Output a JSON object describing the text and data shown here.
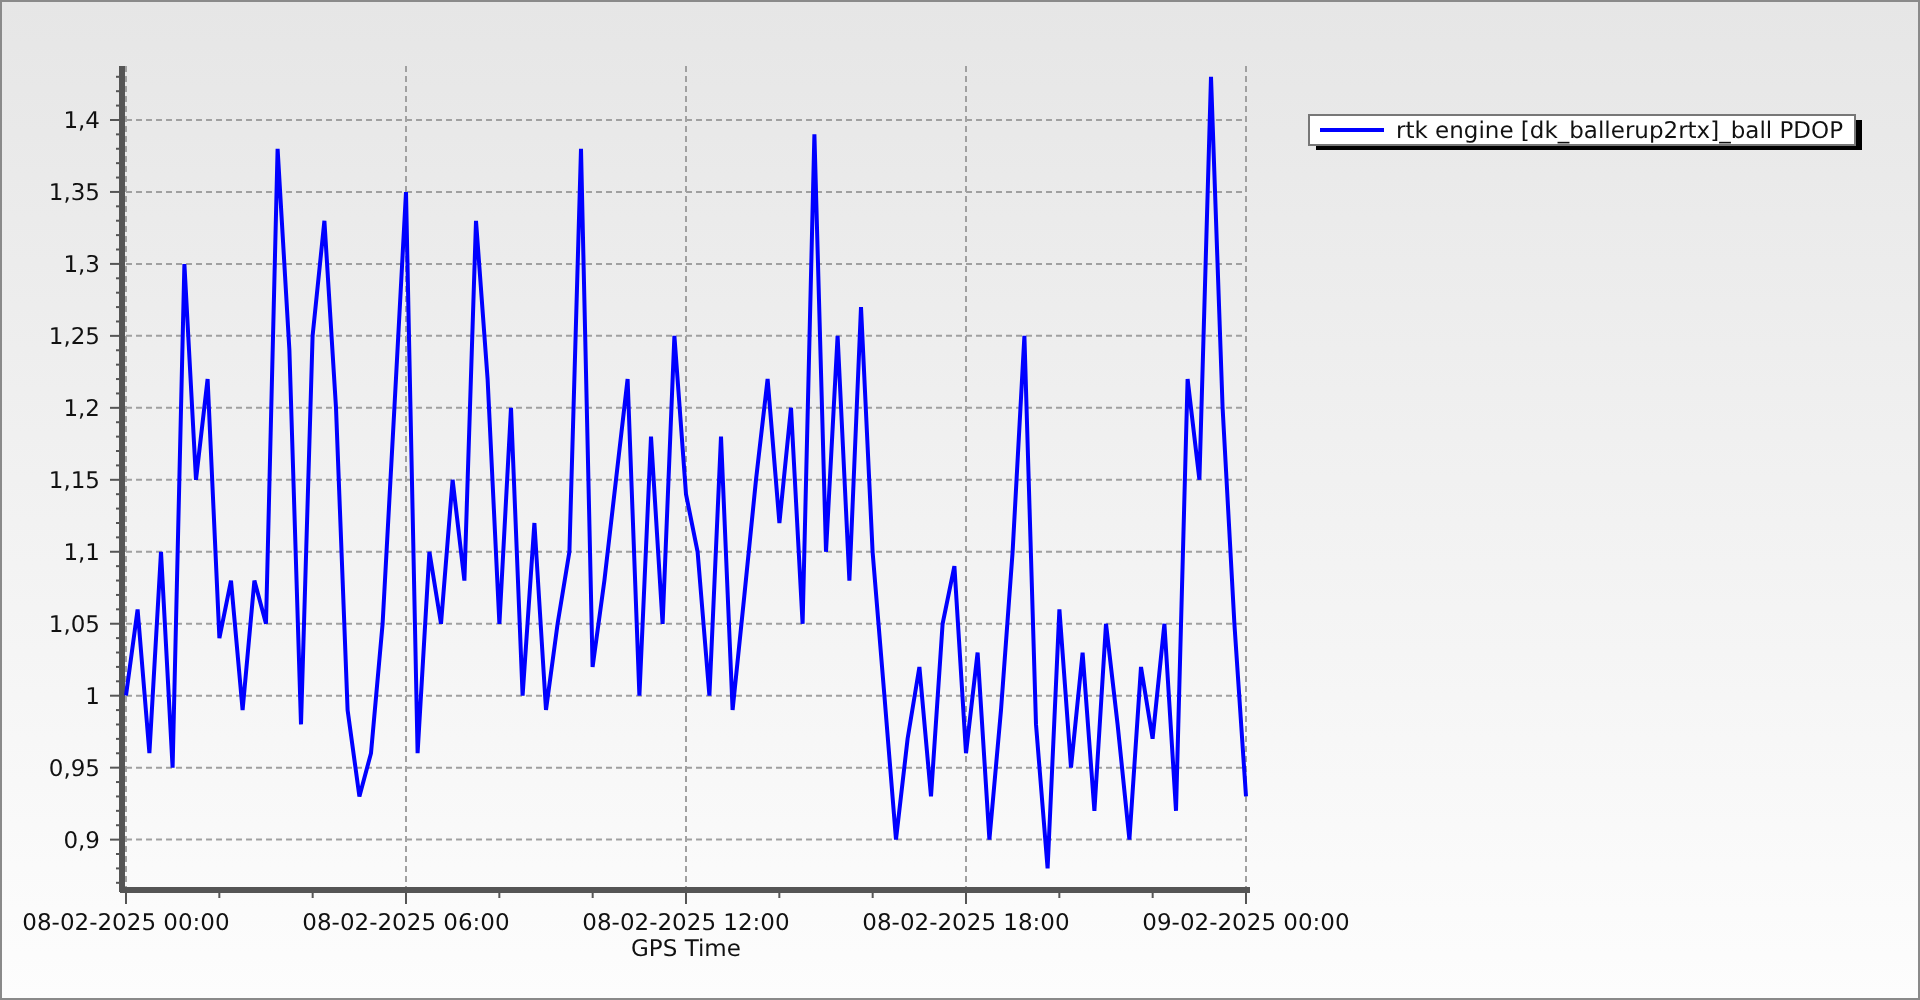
{
  "chart": {
    "chart_data": {
      "type": "line",
      "xlabel": "GPS Time",
      "grid": true,
      "categories": [
        "08-02-2025 00:00",
        null,
        null,
        null,
        null,
        null,
        null,
        null,
        null,
        null,
        null,
        null,
        null,
        null,
        null,
        null,
        null,
        null,
        null,
        null,
        null,
        null,
        null,
        null,
        "08-02-2025 06:00",
        null,
        null,
        null,
        null,
        null,
        null,
        null,
        null,
        null,
        null,
        null,
        null,
        null,
        null,
        null,
        null,
        null,
        null,
        null,
        null,
        null,
        null,
        null,
        "08-02-2025 12:00",
        null,
        null,
        null,
        null,
        null,
        null,
        null,
        null,
        null,
        null,
        null,
        null,
        null,
        null,
        null,
        null,
        null,
        null,
        null,
        null,
        null,
        null,
        null,
        "08-02-2025 18:00",
        null,
        null,
        null,
        null,
        null,
        null,
        null,
        null,
        null,
        null,
        null,
        null,
        null,
        null,
        null,
        null,
        null,
        null,
        null,
        null,
        null,
        null,
        null,
        "09-02-2025 00:00"
      ],
      "series": [
        {
          "name": "rtk engine [dk_ballerup2rtx]_ball PDOP",
          "color": "#0000ff",
          "values": [
            1.0,
            1.06,
            0.96,
            1.1,
            0.95,
            1.3,
            1.15,
            1.22,
            1.04,
            1.08,
            0.99,
            1.08,
            1.05,
            1.38,
            1.24,
            0.98,
            1.25,
            1.33,
            1.2,
            0.99,
            0.93,
            0.96,
            1.05,
            1.2,
            1.35,
            0.96,
            1.1,
            1.05,
            1.15,
            1.08,
            1.33,
            1.22,
            1.05,
            1.2,
            1.0,
            1.12,
            0.99,
            1.05,
            1.1,
            1.38,
            1.02,
            1.08,
            1.15,
            1.22,
            1.0,
            1.18,
            1.05,
            1.25,
            1.14,
            1.1,
            1.0,
            1.18,
            0.99,
            1.07,
            1.15,
            1.22,
            1.12,
            1.2,
            1.05,
            1.39,
            1.1,
            1.25,
            1.08,
            1.27,
            1.1,
            1.0,
            0.9,
            0.97,
            1.02,
            0.93,
            1.05,
            1.09,
            0.96,
            1.03,
            0.9,
            0.99,
            1.1,
            1.25,
            0.98,
            0.88,
            1.06,
            0.95,
            1.03,
            0.92,
            1.05,
            0.98,
            0.9,
            1.02,
            0.97,
            1.05,
            0.92,
            1.22,
            1.15,
            1.43,
            1.2,
            1.05,
            0.93
          ]
        }
      ],
      "ylim": [
        0.865,
        1.4375
      ],
      "yticks": [
        {
          "value": 0.9,
          "label": "0,9"
        },
        {
          "value": 0.95,
          "label": "0,95"
        },
        {
          "value": 1,
          "label": "1"
        },
        {
          "value": 1.05,
          "label": "1,05"
        },
        {
          "value": 1.1,
          "label": "1,1"
        },
        {
          "value": 1.15,
          "label": "1,15"
        },
        {
          "value": 1.2,
          "label": "1,2"
        },
        {
          "value": 1.25,
          "label": "1,25"
        },
        {
          "value": 1.3,
          "label": "1,3"
        },
        {
          "value": 1.35,
          "label": "1,35"
        },
        {
          "value": 1.4,
          "label": "1,4"
        }
      ]
    }
  }
}
